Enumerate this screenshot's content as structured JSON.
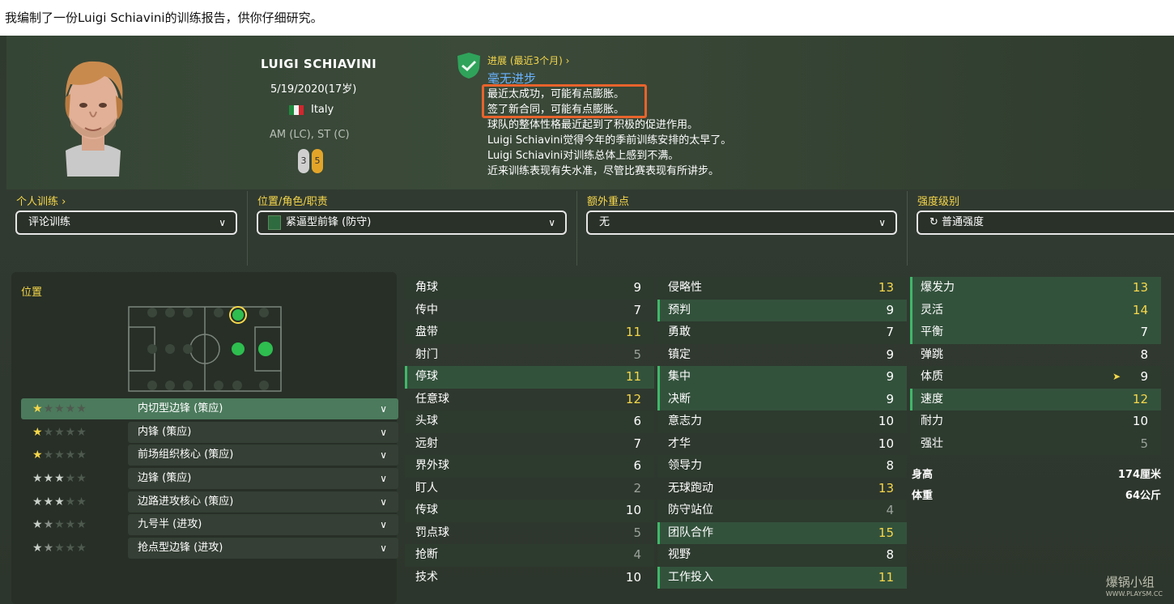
{
  "caption": "我编制了一份Luigi Schiavini的训练报告，供你仔细研究。",
  "player": {
    "name": "LUIGI SCHIAVINI",
    "dob": "5/19/2020(17岁)",
    "nation": "Italy",
    "positions": "AM (LC), ST (C)",
    "left_foot": "3",
    "right_foot": "5"
  },
  "progress": {
    "link": "进展 (最近3个月) ›",
    "status": "毫无进步",
    "notes": [
      "最近太成功，可能有点膨胀。",
      "签了新合同，可能有点膨胀。",
      "球队的整体性格最近起到了积极的促进作用。",
      "Luigi Schiavini觉得今年的季前训练安排的太早了。",
      "Luigi Schiavini对训练总体上感到不满。",
      "近来训练表现有失水准，尽管比赛表现有所讲步。"
    ]
  },
  "dropdowns": {
    "personal_label": "个人训练 ›",
    "personal_value": "评论训练",
    "role_label": "位置/角色/职责",
    "role_value": "紧逼型前锋 (防守)",
    "focus_label": "额外重点",
    "focus_value": "无",
    "intensity_label": "强度级别",
    "intensity_value": "普通强度"
  },
  "positions_panel": {
    "title": "位置",
    "roles": [
      {
        "name": "内切型边锋 (策应)",
        "stars": 1
      },
      {
        "name": "内锋 (策应)",
        "stars": 1
      },
      {
        "name": "前场组织核心 (策应)",
        "stars": 1
      },
      {
        "name": "边锋 (策应)",
        "stars": 3
      },
      {
        "name": "边路进攻核心 (策应)",
        "stars": 3
      },
      {
        "name": "九号半 (进攻)",
        "stars": 1.5
      },
      {
        "name": "抢点型边锋 (进攻)",
        "stars": 1.5
      }
    ]
  },
  "technical": [
    {
      "name": "角球",
      "value": "9"
    },
    {
      "name": "传中",
      "value": "7"
    },
    {
      "name": "盘带",
      "value": "11"
    },
    {
      "name": "射门",
      "value": "5"
    },
    {
      "name": "停球",
      "value": "11"
    },
    {
      "name": "任意球",
      "value": "12"
    },
    {
      "name": "头球",
      "value": "6"
    },
    {
      "name": "远射",
      "value": "7"
    },
    {
      "name": "界外球",
      "value": "6"
    },
    {
      "name": "盯人",
      "value": "2"
    },
    {
      "name": "传球",
      "value": "10"
    },
    {
      "name": "罚点球",
      "value": "5"
    },
    {
      "name": "抢断",
      "value": "4"
    },
    {
      "name": "技术",
      "value": "10"
    }
  ],
  "mental": [
    {
      "name": "侵略性",
      "value": "13"
    },
    {
      "name": "预判",
      "value": "9"
    },
    {
      "name": "勇敢",
      "value": "7"
    },
    {
      "name": "镇定",
      "value": "9"
    },
    {
      "name": "集中",
      "value": "9"
    },
    {
      "name": "决断",
      "value": "9"
    },
    {
      "name": "意志力",
      "value": "10"
    },
    {
      "name": "才华",
      "value": "10"
    },
    {
      "name": "领导力",
      "value": "8"
    },
    {
      "name": "无球跑动",
      "value": "13"
    },
    {
      "name": "防守站位",
      "value": "4"
    },
    {
      "name": "团队合作",
      "value": "15"
    },
    {
      "name": "视野",
      "value": "8"
    },
    {
      "name": "工作投入",
      "value": "11"
    }
  ],
  "physical": [
    {
      "name": "爆发力",
      "value": "13"
    },
    {
      "name": "灵活",
      "value": "14"
    },
    {
      "name": "平衡",
      "value": "7"
    },
    {
      "name": "弹跳",
      "value": "8"
    },
    {
      "name": "体质",
      "value": "9"
    },
    {
      "name": "速度",
      "value": "12"
    },
    {
      "name": "耐力",
      "value": "10"
    },
    {
      "name": "强壮",
      "value": "5"
    }
  ],
  "body": {
    "height_label": "身高",
    "height_value": "174厘米",
    "weight_label": "体重",
    "weight_value": "64公斤"
  },
  "watermark": {
    "main": "爆锅小组",
    "sub": "WWW.PLAYSM.CC"
  },
  "colors": {
    "accent_yellow": "#f6d74a",
    "accent_green": "#3fb86a",
    "status_blue": "#6ab2ff",
    "highlight_orange": "#e8632c"
  }
}
